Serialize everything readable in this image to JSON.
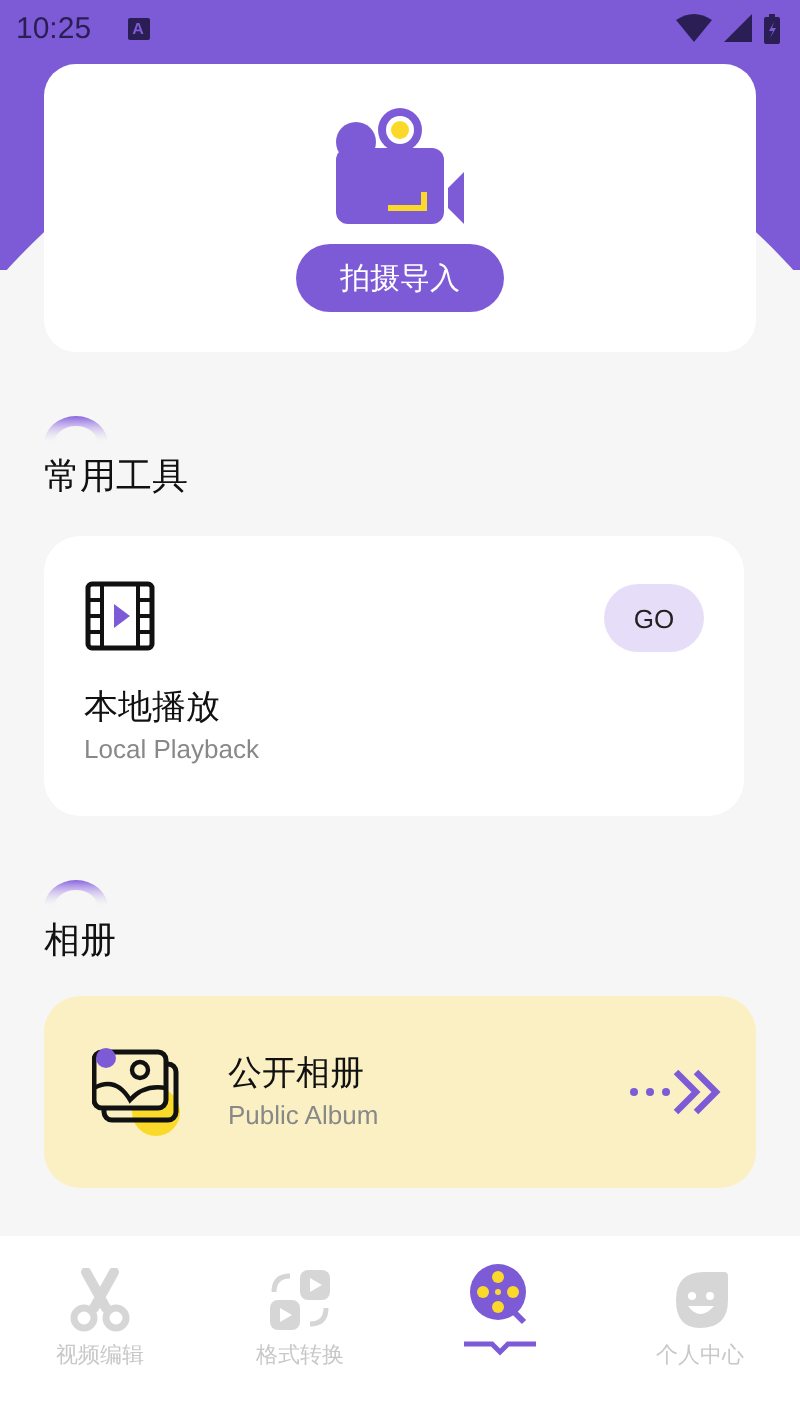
{
  "status_bar": {
    "time": "10:25",
    "notification": "A"
  },
  "banner": {
    "button": "拍摄导入"
  },
  "sections": [
    {
      "title": "常用工具",
      "card": {
        "kind": "tool",
        "title": "本地播放",
        "subtitle": "Local Playback",
        "button": "GO"
      }
    },
    {
      "title": "相册",
      "card": {
        "kind": "album",
        "title": "公开相册",
        "subtitle": "Public Album"
      }
    }
  ],
  "tabs": [
    {
      "label": "视频编辑",
      "selected": false
    },
    {
      "label": "格式转换",
      "selected": false
    },
    {
      "selected": true
    },
    {
      "label": "个人中心",
      "selected": false
    }
  ]
}
